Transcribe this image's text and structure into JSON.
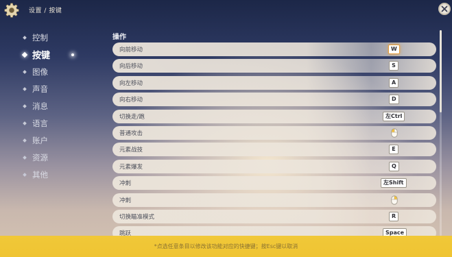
{
  "header": {
    "breadcrumb_root": "设置",
    "breadcrumb_sep": "/",
    "breadcrumb_current": "按键"
  },
  "sidebar": {
    "items": [
      {
        "label": "控制"
      },
      {
        "label": "按键",
        "active": true
      },
      {
        "label": "图像"
      },
      {
        "label": "声音"
      },
      {
        "label": "消息"
      },
      {
        "label": "语言"
      },
      {
        "label": "账户"
      },
      {
        "label": "资源"
      },
      {
        "label": "其他"
      }
    ]
  },
  "main": {
    "section_title": "操作",
    "rows": [
      {
        "action": "向前移动",
        "key": "W",
        "selected": true
      },
      {
        "action": "向后移动",
        "key": "S"
      },
      {
        "action": "向左移动",
        "key": "A"
      },
      {
        "action": "向右移动",
        "key": "D"
      },
      {
        "action": "切换走/跑",
        "key": "左Ctrl"
      },
      {
        "action": "普通攻击",
        "key": "",
        "icon": "mouse-left-icon"
      },
      {
        "action": "元素战技",
        "key": "E"
      },
      {
        "action": "元素爆发",
        "key": "Q"
      },
      {
        "action": "冲刺",
        "key": "左Shift"
      },
      {
        "action": "冲刺",
        "key": "",
        "icon": "mouse-right-icon"
      },
      {
        "action": "切换瞄准模式",
        "key": "R"
      },
      {
        "action": "跳跃",
        "key": "Space"
      }
    ]
  },
  "footer": {
    "hint": "*点选任意条目以修改该功能对应的快捷键；按Esc键以取消"
  },
  "colors": {
    "footer_bg": "#efc433",
    "row_bg": "#ece5db",
    "selected_border": "#e39b3a"
  }
}
